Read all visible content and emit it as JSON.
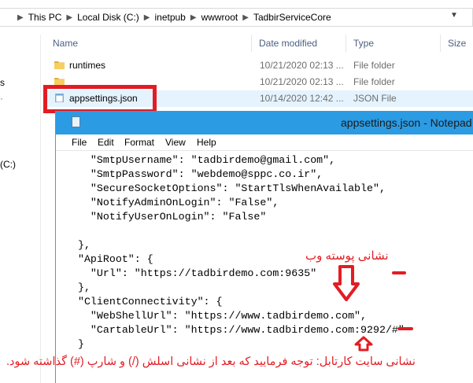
{
  "breadcrumb": {
    "items": [
      "This PC",
      "Local Disk (C:)",
      "inetpub",
      "wwwroot",
      "TadbirServiceCore"
    ]
  },
  "columns": {
    "name": "Name",
    "date": "Date modified",
    "type": "Type",
    "size": "Size"
  },
  "files": [
    {
      "name": "runtimes",
      "date": "10/21/2020 02:13 ...",
      "type": "File folder"
    },
    {
      "name": "",
      "date": "10/21/2020 02:13 ...",
      "type": "File folder"
    },
    {
      "name": "appsettings.json",
      "date": "10/14/2020 12:42 ...",
      "type": "JSON File"
    }
  ],
  "nav": {
    "frag_s": "s",
    "frag_dot": "·",
    "frag_drive": "(C:)"
  },
  "notepad": {
    "title": "appsettings.json - Notepad",
    "menu": [
      "File",
      "Edit",
      "Format",
      "View",
      "Help"
    ],
    "lines": [
      "    \"SmtpUsername\": \"tadbirdemo@gmail.com\",",
      "    \"SmtpPassword\": \"webdemo@sppc.co.ir\",",
      "    \"SecureSocketOptions\": \"StartTlsWhenAvailable\",",
      "    \"NotifyAdminOnLogin\": \"False\",",
      "    \"NotifyUserOnLogin\": \"False\"",
      "",
      "  },",
      "  \"ApiRoot\": {",
      "    \"Url\": \"https://tadbirdemo.com:9635\"",
      "  },",
      "  \"ClientConnectivity\": {",
      "    \"WebShellUrl\": \"https://www.tadbirdemo.com\",",
      "    \"CartableUrl\": \"https://www.tadbirdemo.com:9292/#\"",
      "  }"
    ]
  },
  "annotations": {
    "web_label": "نشانی پوسته وب",
    "site_label": "نشانی سایت کارتابل: توجه فرمایید که بعد از نشانی اسلش (/) و شارپ (#) گذاشته شود."
  },
  "colors": {
    "accent_red": "#e31c23",
    "title_blue": "#2b9be3",
    "selection": "#e5f3ff"
  }
}
